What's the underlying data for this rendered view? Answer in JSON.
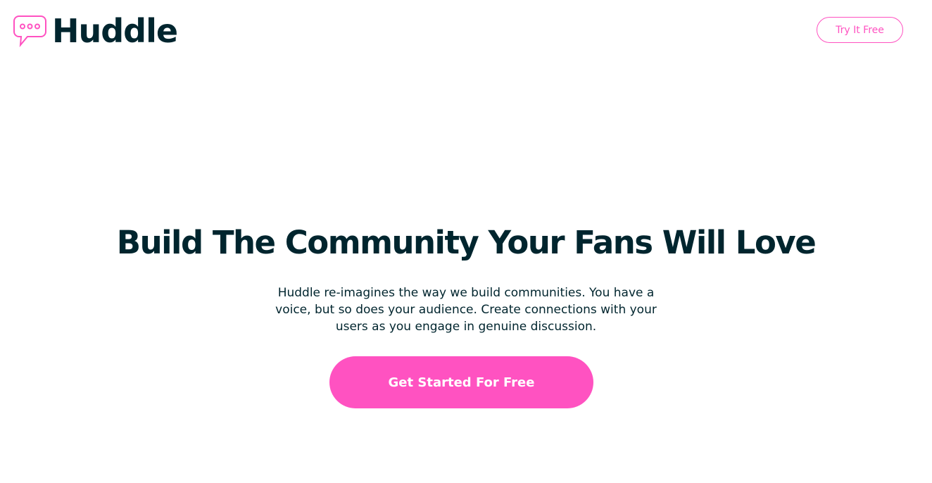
{
  "header": {
    "logo_text": "Huddle",
    "try_button_label": "Try It Free"
  },
  "hero": {
    "title": "Build The Community Your Fans Will Love",
    "description": "Huddle re-imagines the way we build communities. You have a voice, but so does your audience. Create connections with your users as you engage in genuine discussion.",
    "cta_label": "Get Started For Free"
  },
  "colors": {
    "accent": "#ff52c1",
    "text_dark": "#00252e",
    "background": "#ffffff"
  },
  "icons": {
    "logo": "chat-bubble-icon"
  }
}
